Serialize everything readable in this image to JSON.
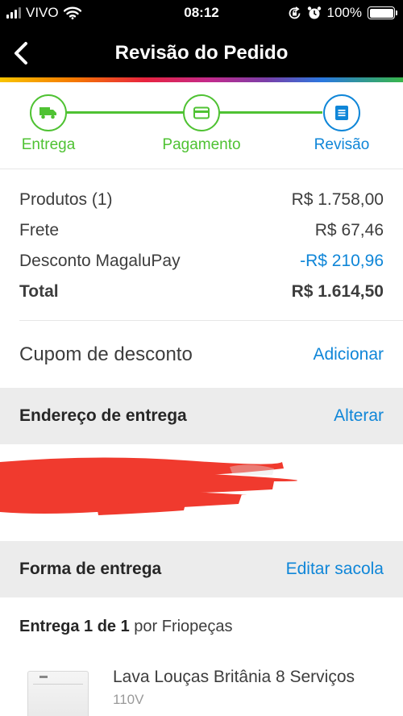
{
  "status_bar": {
    "carrier": "VIVO",
    "time": "08:12",
    "battery": "100%",
    "battery_level": 1.0
  },
  "header": {
    "title": "Revisão do Pedido",
    "back_icon": "chevron-left-icon"
  },
  "stepper": {
    "steps": [
      {
        "label": "Entrega",
        "icon": "truck-icon",
        "state": "done"
      },
      {
        "label": "Pagamento",
        "icon": "credit-card-icon",
        "state": "done"
      },
      {
        "label": "Revisão",
        "icon": "document-list-icon",
        "state": "current"
      }
    ]
  },
  "summary": {
    "rows": [
      {
        "label": "Produtos (1)",
        "value": "R$ 1.758,00"
      },
      {
        "label": "Frete",
        "value": "R$ 67,46"
      },
      {
        "label": "Desconto MagaluPay",
        "value": "-R$ 210,96"
      },
      {
        "label": "Total",
        "value": "R$ 1.614,50"
      }
    ]
  },
  "coupon": {
    "label": "Cupom de desconto",
    "action": "Adicionar"
  },
  "address_section": {
    "title": "Endereço de entrega",
    "action": "Alterar"
  },
  "delivery_section": {
    "title": "Forma de entrega",
    "action": "Editar sacola"
  },
  "delivery": {
    "prefix": "Entrega 1 de 1",
    "seller": " por Friopeças"
  },
  "product": {
    "title": "Lava Louças Britânia 8 Serviços",
    "variant": "110V"
  },
  "colors": {
    "accent_blue": "#0f86d8",
    "step_green": "#4fc233",
    "redaction_red": "#f03a2e",
    "header_bg": "#000000"
  }
}
